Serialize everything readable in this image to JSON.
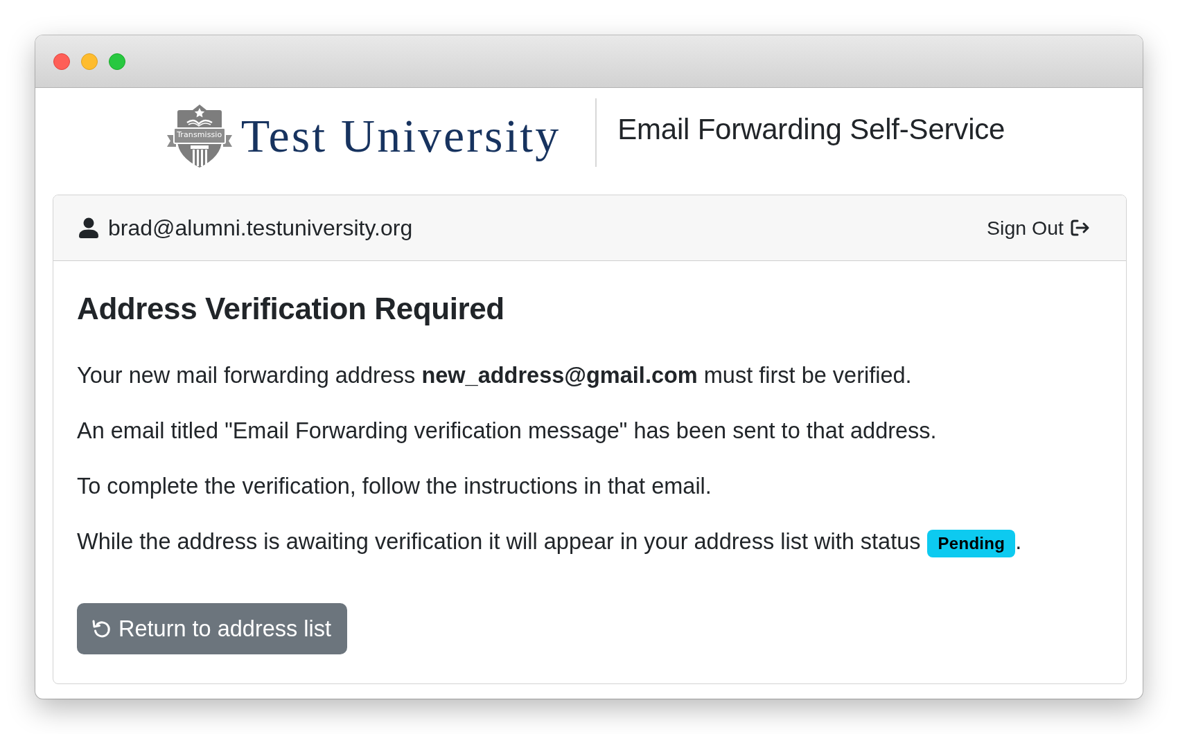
{
  "header": {
    "logo": {
      "emblem_text": "Transmissio",
      "name": "Test University"
    },
    "title": "Email Forwarding Self-Service"
  },
  "account": {
    "user": "brad@alumni.testuniversity.org",
    "sign_out": "Sign Out"
  },
  "notice": {
    "heading": "Address Verification Required",
    "paragraphs": [
      {
        "text": "Your new mail forwarding address **new_address@gmail.com** must first be verified."
      },
      {
        "text": "An email titled \"Email Forwarding verification message\" has been sent to that address."
      },
      {
        "text": "To complete the verification, follow the instructions in that email."
      },
      {
        "text": "While the address is awaiting verification it will appear in your address list with status",
        "badge": "Pending",
        "text_after": "."
      }
    ],
    "button": "Return to address list"
  }
}
